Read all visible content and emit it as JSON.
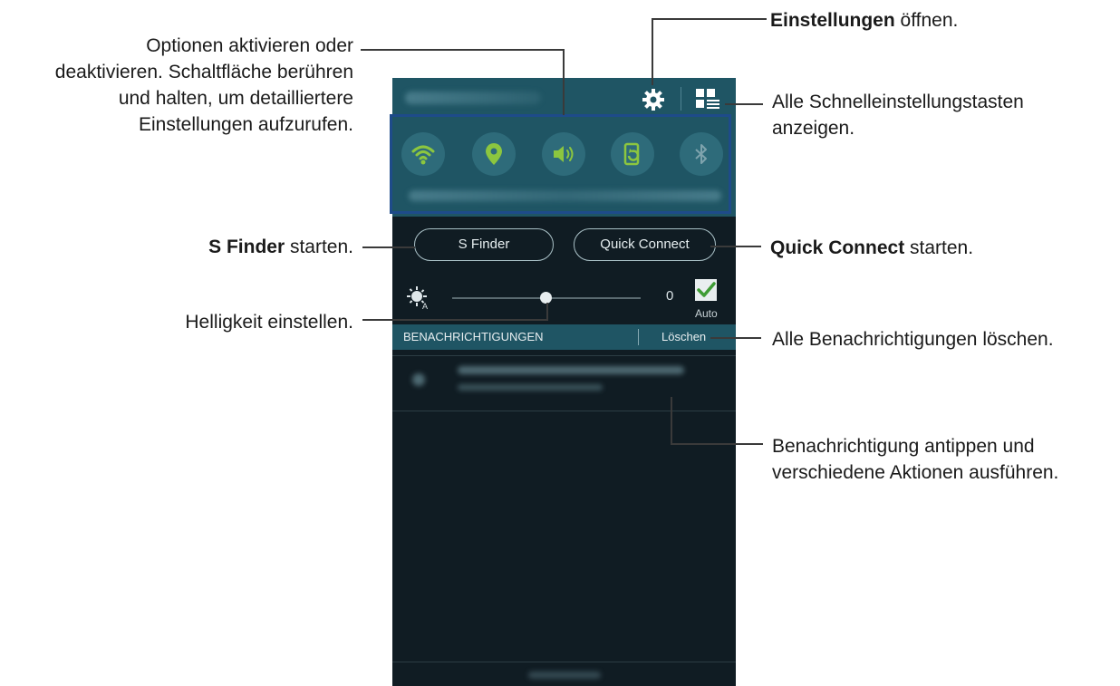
{
  "annotations": {
    "options_line1": "Optionen aktivieren oder",
    "options_line2": "deaktivieren. Schaltfläche berühren",
    "options_line3": "und halten, um detailliertere",
    "options_line4": "Einstellungen aufzurufen.",
    "settings_bold": "Einstellungen",
    "settings_rest": " öffnen.",
    "all_quick_line1": "Alle Schnelleinstellungstasten",
    "all_quick_line2": "anzeigen.",
    "sfinder_bold": "S Finder",
    "sfinder_rest": " starten.",
    "quickconnect_bold": "Quick Connect",
    "quickconnect_rest": " starten.",
    "brightness": "Helligkeit einstellen.",
    "clear_all": "Alle Benachrichtigungen löschen.",
    "tap_line1": "Benachrichtigung antippen und",
    "tap_line2": "verschiedene Aktionen ausführen."
  },
  "phone": {
    "quick_settings": [
      {
        "icon": "wifi-icon",
        "active": true
      },
      {
        "icon": "location-icon",
        "active": true
      },
      {
        "icon": "sound-icon",
        "active": true
      },
      {
        "icon": "screen-rotation-icon",
        "active": true
      },
      {
        "icon": "bluetooth-icon",
        "active": false
      }
    ],
    "sfinder_label": "S Finder",
    "quickconnect_label": "Quick Connect",
    "brightness_value": "0",
    "auto_label": "Auto",
    "auto_checked": true,
    "notifications_title": "BENACHRICHTIGUNGEN",
    "clear_label": "Löschen"
  },
  "colors": {
    "accent_green": "#8cc63f",
    "panel_teal": "#1f5564",
    "background_dark": "#101c23",
    "highlight_blue": "#1e4b8a"
  }
}
